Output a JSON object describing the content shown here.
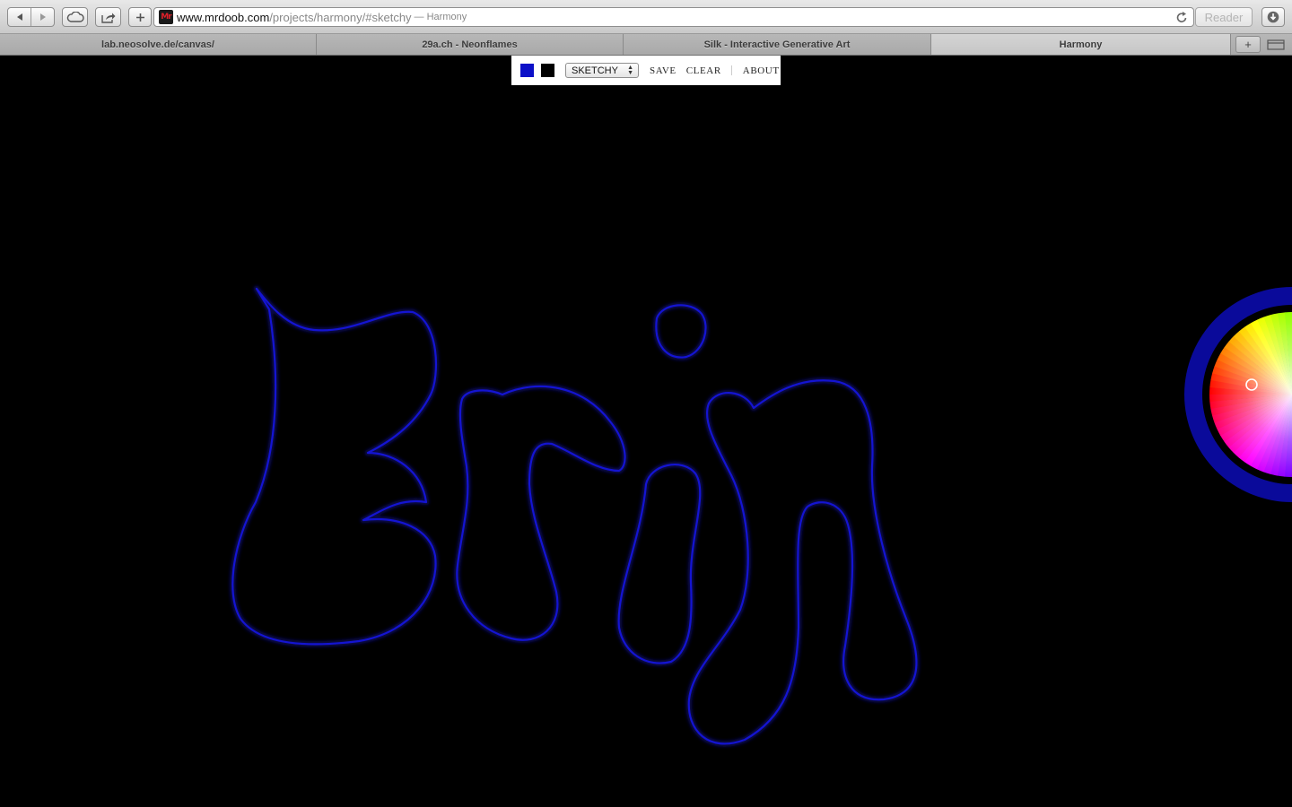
{
  "browser": {
    "url_host": "www.mrdoob.com",
    "url_path": "/projects/harmony/#sketchy",
    "page_title": " — Harmony",
    "favicon_text": "Mr",
    "reader_label": "Reader",
    "new_tab_label": "+",
    "tabs": [
      {
        "label": "lab.neosolve.de/canvas/",
        "active": false
      },
      {
        "label": "29a.ch - Neonflames",
        "active": false
      },
      {
        "label": "Silk - Interactive Generative Art",
        "active": false
      },
      {
        "label": "Harmony",
        "active": true
      }
    ]
  },
  "app": {
    "foreground_color": "#0c10c8",
    "background_color": "#000000",
    "brush": "SKETCHY",
    "menu": {
      "save_label": "SAVE",
      "clear_label": "CLEAR",
      "about_label": "ABOUT"
    }
  },
  "canvas": {
    "stroke_color": "#1414d2",
    "drawn_word": "Erin"
  },
  "icons": {
    "back": "back-arrow-icon",
    "forward": "forward-arrow-icon",
    "icloud": "cloud-icon",
    "share": "share-icon",
    "add_bookmark": "plus-icon",
    "reload": "reload-icon",
    "downloads": "download-icon",
    "tab_list": "tab-list-icon"
  }
}
